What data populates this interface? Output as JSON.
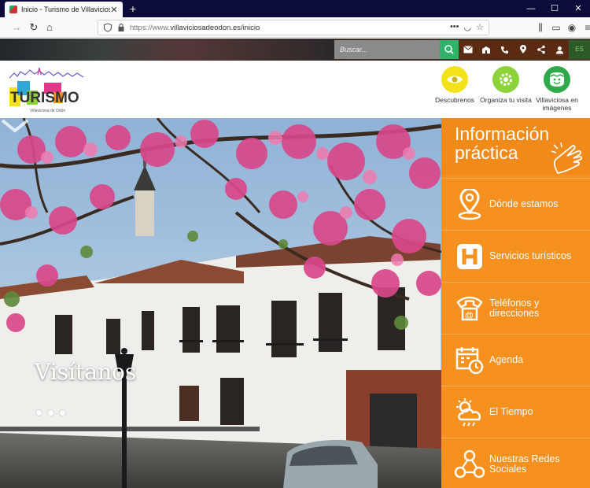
{
  "browser": {
    "tab_title": "Inicio - Turismo de Villaviciosa",
    "new_tab": "+",
    "url_proto": "https://www.",
    "url_rest": "villaviciosadeodon.es/inicio",
    "url_menu": "•••",
    "win_min": "—",
    "win_max": "☐",
    "win_close": "✕"
  },
  "site": {
    "search_placeholder": "Buscar...",
    "lang": "ES",
    "logo_text": "TURISMO",
    "logo_sub": "Villaviciosa de Odón",
    "nav": [
      {
        "label": "Descubrenos",
        "color": "#f2e21a"
      },
      {
        "label": "Organiza tu visita",
        "color": "#8ed23a"
      },
      {
        "label": "Villaviciosa en imágenes",
        "color": "#2faa4a"
      }
    ]
  },
  "hero": {
    "title": "Visítanos"
  },
  "info": {
    "title": "Información práctica",
    "items": [
      {
        "label": "Dónde estamos"
      },
      {
        "label": "Servicios turísticos"
      },
      {
        "label": "Teléfonos y direcciones"
      },
      {
        "label": "Agenda"
      },
      {
        "label": "El Tiempo"
      },
      {
        "label": "Nuestras Redes Sociales"
      }
    ]
  },
  "colors": {
    "accent_orange": "#f6901e",
    "search_green": "#2fb36a",
    "icons_bar": "#5b2a12"
  }
}
